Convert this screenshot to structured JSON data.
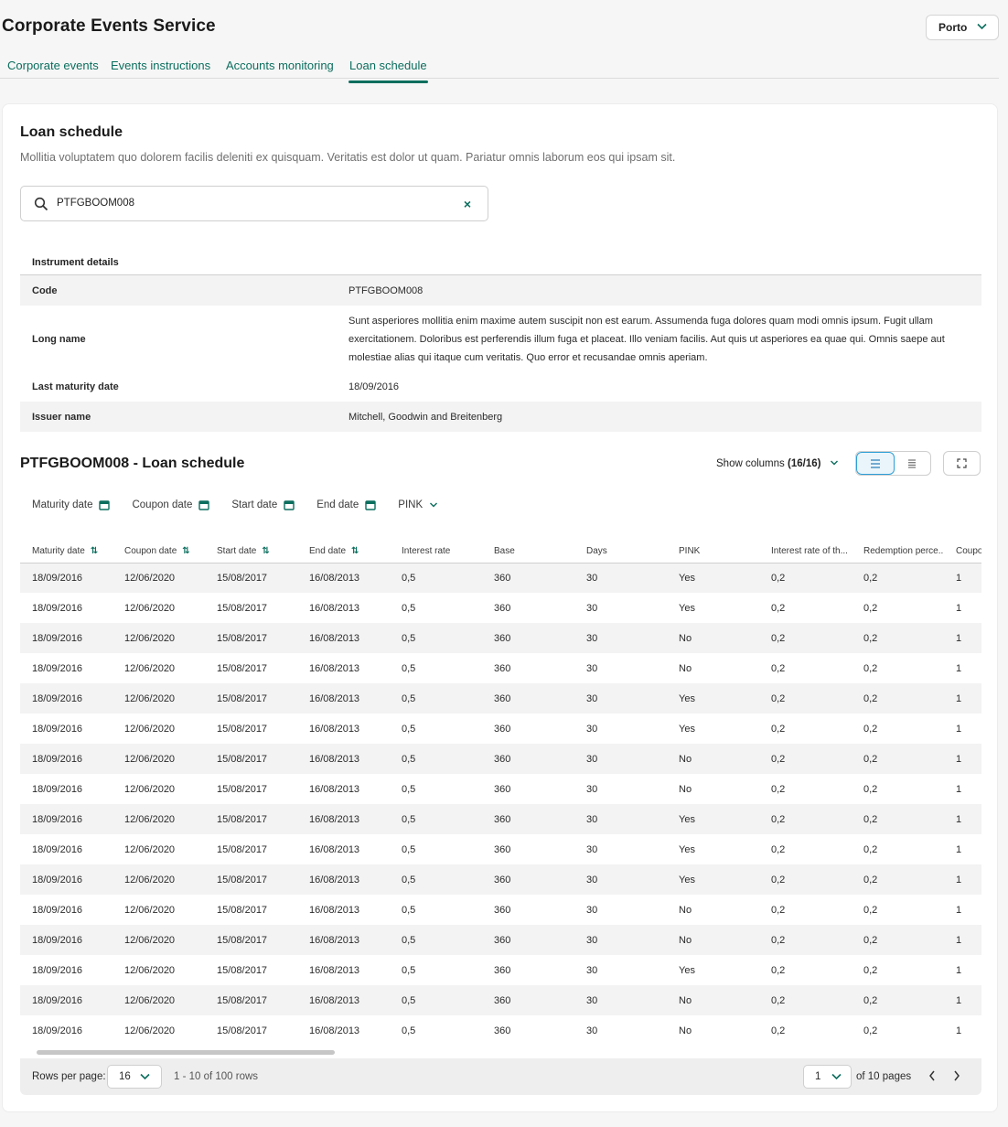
{
  "app": {
    "title": "Corporate Events Service",
    "region": "Porto"
  },
  "tabs": [
    {
      "label": "Corporate events"
    },
    {
      "label": "Events instructions"
    },
    {
      "label": "Accounts monitoring"
    },
    {
      "label": "Loan schedule"
    }
  ],
  "page": {
    "title": "Loan schedule",
    "description": "Mollitia voluptatem quo dolorem facilis deleniti ex quisquam. Veritatis est dolor ut quam. Pariatur omnis laborum eos qui ipsam sit."
  },
  "search": {
    "value": "PTFGBOOM008",
    "clear_icon": "×"
  },
  "instrument": {
    "header": "Instrument details",
    "rows": [
      {
        "key": "Code",
        "value": "PTFGBOOM008"
      },
      {
        "key": "Long name",
        "value": "Sunt asperiores mollitia enim maxime autem suscipit non est earum. Assumenda fuga dolores quam modi omnis ipsum. Fugit ullam exercitationem. Doloribus est perferendis illum fuga et placeat. Illo veniam facilis. Aut quis ut asperiores ea quae qui. Omnis saepe aut molestiae alias qui itaque cum veritatis. Quo error et recusandae omnis aperiam."
      },
      {
        "key": "Last maturity date",
        "value": "18/09/2016"
      },
      {
        "key": "Issuer name",
        "value": "Mitchell, Goodwin and Breitenberg"
      }
    ]
  },
  "schedule": {
    "title": "PTFGBOOM008 - Loan schedule",
    "show_columns_label": "Show columns",
    "show_columns_count": "(16/16)",
    "filters": [
      "Maturity date",
      "Coupon date",
      "Start date",
      "End date",
      "PINK"
    ],
    "columns": [
      "Maturity date",
      "Coupon date",
      "Start date",
      "End date",
      "Interest rate",
      "Base",
      "Days",
      "PINK",
      "Interest rate of th...",
      "Redemption perce...",
      "Coupo"
    ],
    "rows": [
      [
        "18/09/2016",
        "12/06/2020",
        "15/08/2017",
        "16/08/2013",
        "0,5",
        "360",
        "30",
        "Yes",
        "0,2",
        "0,2",
        "1"
      ],
      [
        "18/09/2016",
        "12/06/2020",
        "15/08/2017",
        "16/08/2013",
        "0,5",
        "360",
        "30",
        "Yes",
        "0,2",
        "0,2",
        "1"
      ],
      [
        "18/09/2016",
        "12/06/2020",
        "15/08/2017",
        "16/08/2013",
        "0,5",
        "360",
        "30",
        "No",
        "0,2",
        "0,2",
        "1"
      ],
      [
        "18/09/2016",
        "12/06/2020",
        "15/08/2017",
        "16/08/2013",
        "0,5",
        "360",
        "30",
        "No",
        "0,2",
        "0,2",
        "1"
      ],
      [
        "18/09/2016",
        "12/06/2020",
        "15/08/2017",
        "16/08/2013",
        "0,5",
        "360",
        "30",
        "Yes",
        "0,2",
        "0,2",
        "1"
      ],
      [
        "18/09/2016",
        "12/06/2020",
        "15/08/2017",
        "16/08/2013",
        "0,5",
        "360",
        "30",
        "Yes",
        "0,2",
        "0,2",
        "1"
      ],
      [
        "18/09/2016",
        "12/06/2020",
        "15/08/2017",
        "16/08/2013",
        "0,5",
        "360",
        "30",
        "No",
        "0,2",
        "0,2",
        "1"
      ],
      [
        "18/09/2016",
        "12/06/2020",
        "15/08/2017",
        "16/08/2013",
        "0,5",
        "360",
        "30",
        "No",
        "0,2",
        "0,2",
        "1"
      ],
      [
        "18/09/2016",
        "12/06/2020",
        "15/08/2017",
        "16/08/2013",
        "0,5",
        "360",
        "30",
        "Yes",
        "0,2",
        "0,2",
        "1"
      ],
      [
        "18/09/2016",
        "12/06/2020",
        "15/08/2017",
        "16/08/2013",
        "0,5",
        "360",
        "30",
        "Yes",
        "0,2",
        "0,2",
        "1"
      ],
      [
        "18/09/2016",
        "12/06/2020",
        "15/08/2017",
        "16/08/2013",
        "0,5",
        "360",
        "30",
        "Yes",
        "0,2",
        "0,2",
        "1"
      ],
      [
        "18/09/2016",
        "12/06/2020",
        "15/08/2017",
        "16/08/2013",
        "0,5",
        "360",
        "30",
        "No",
        "0,2",
        "0,2",
        "1"
      ],
      [
        "18/09/2016",
        "12/06/2020",
        "15/08/2017",
        "16/08/2013",
        "0,5",
        "360",
        "30",
        "No",
        "0,2",
        "0,2",
        "1"
      ],
      [
        "18/09/2016",
        "12/06/2020",
        "15/08/2017",
        "16/08/2013",
        "0,5",
        "360",
        "30",
        "Yes",
        "0,2",
        "0,2",
        "1"
      ],
      [
        "18/09/2016",
        "12/06/2020",
        "15/08/2017",
        "16/08/2013",
        "0,5",
        "360",
        "30",
        "No",
        "0,2",
        "0,2",
        "1"
      ],
      [
        "18/09/2016",
        "12/06/2020",
        "15/08/2017",
        "16/08/2013",
        "0,5",
        "360",
        "30",
        "No",
        "0,2",
        "0,2",
        "1"
      ]
    ]
  },
  "pagination": {
    "rows_per_page_label": "Rows per page:",
    "rows_per_page": "16",
    "range": "1 - 10 of 100 rows",
    "page": "1",
    "pages_label": "of 10 pages"
  },
  "colors": {
    "accent": "#0b6e5e",
    "toggle_active": "#2d9fd8"
  }
}
